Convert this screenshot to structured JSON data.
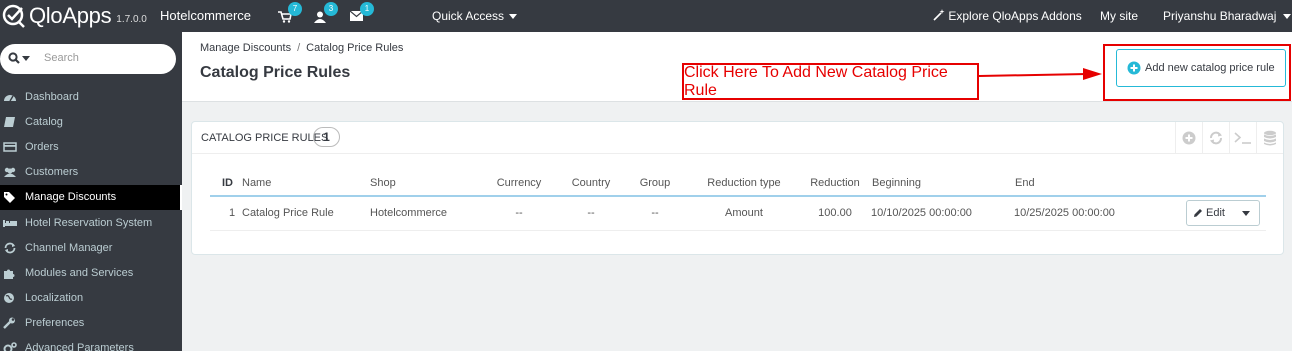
{
  "topbar": {
    "brand": "QloApps",
    "version": "1.7.0.0",
    "shop_name": "Hotelcommerce",
    "notifications": [
      {
        "icon": "cart-icon",
        "count": "7"
      },
      {
        "icon": "user-icon",
        "count": "3"
      },
      {
        "icon": "envelope-icon",
        "count": "1"
      }
    ],
    "quick_access": "Quick Access",
    "explore_addons": "Explore QloApps Addons",
    "my_site": "My site",
    "user_name": "Priyanshu Bharadwaj"
  },
  "sidebar": {
    "search_placeholder": "Search",
    "items": [
      {
        "label": "Dashboard",
        "icon": "dashboard-icon"
      },
      {
        "label": "Catalog",
        "icon": "book-icon"
      },
      {
        "label": "Orders",
        "icon": "credit-card-icon"
      },
      {
        "label": "Customers",
        "icon": "users-icon"
      },
      {
        "label": "Manage Discounts",
        "icon": "tags-icon",
        "active": true
      },
      {
        "label": "Hotel Reservation System",
        "icon": "bed-icon"
      },
      {
        "label": "Channel Manager",
        "icon": "refresh-icon"
      },
      {
        "label": "Modules and Services",
        "icon": "puzzle-icon"
      },
      {
        "label": "Localization",
        "icon": "globe-icon"
      },
      {
        "label": "Preferences",
        "icon": "wrench-icon"
      },
      {
        "label": "Advanced Parameters",
        "icon": "cogs-icon"
      }
    ]
  },
  "header": {
    "breadcrumb": [
      "Manage Discounts",
      "Catalog Price Rules"
    ],
    "title": "Catalog Price Rules",
    "add_button": "Add new catalog price rule",
    "callout": "Click Here To Add New Catalog Price Rule"
  },
  "panel": {
    "title": "CATALOG PRICE RULES",
    "count": "1",
    "columns": [
      "ID",
      "Name",
      "Shop",
      "Currency",
      "Country",
      "Group",
      "Reduction type",
      "Reduction",
      "Beginning",
      "End"
    ],
    "rows": [
      {
        "id": "1",
        "name": "Catalog Price Rule",
        "shop": "Hotelcommerce",
        "currency": "--",
        "country": "--",
        "group": "--",
        "reduction_type": "Amount",
        "reduction": "100.00",
        "beginning": "10/10/2025 00:00:00",
        "end": "10/25/2025 00:00:00",
        "action": "Edit"
      }
    ]
  },
  "colors": {
    "topbar": "#363a41",
    "accent": "#25b9d7",
    "annotation": "#e60000"
  }
}
